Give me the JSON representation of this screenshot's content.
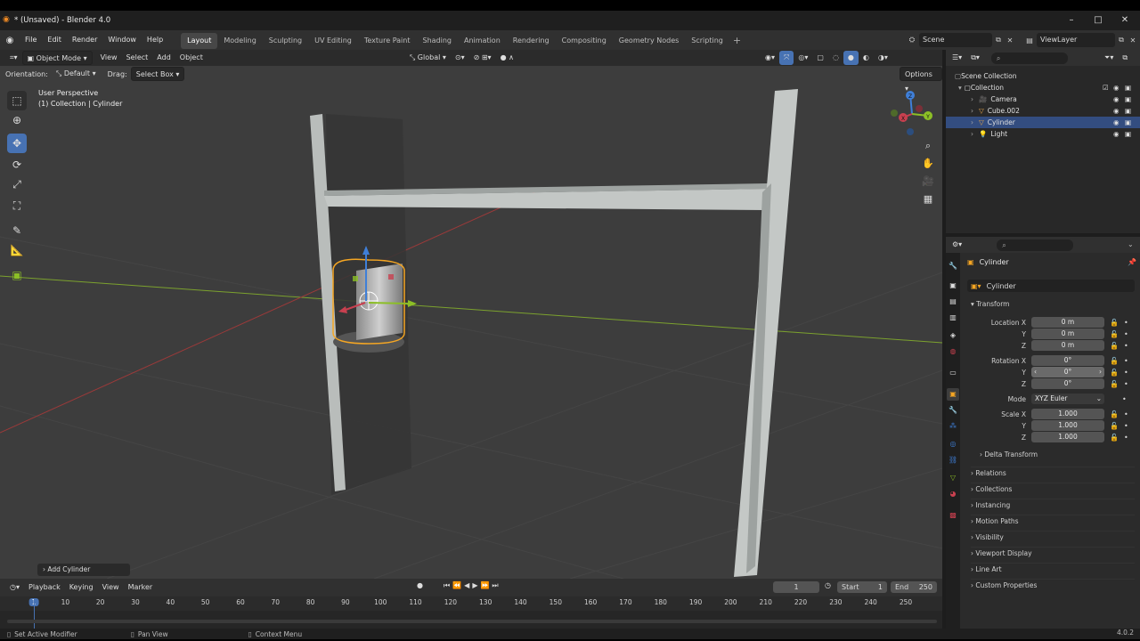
{
  "app": {
    "title": "* (Unsaved) - Blender 4.0",
    "version": "4.0.2"
  },
  "menus": [
    "File",
    "Edit",
    "Render",
    "Window",
    "Help"
  ],
  "workspaces": [
    "Layout",
    "Modeling",
    "Sculpting",
    "UV Editing",
    "Texture Paint",
    "Shading",
    "Animation",
    "Rendering",
    "Compositing",
    "Geometry Nodes",
    "Scripting"
  ],
  "active_workspace": "Layout",
  "scene": {
    "name": "Scene",
    "view_layer": "ViewLayer"
  },
  "viewport": {
    "mode": "Object Mode",
    "menus": [
      "View",
      "Select",
      "Add",
      "Object"
    ],
    "transform_space": "Global",
    "orientation_label": "Orientation:",
    "orientation_value": "Default",
    "drag_label": "Drag:",
    "drag_value": "Select Box",
    "options_label": "Options",
    "perspective": "User Perspective",
    "collection_info": "(1) Collection | Cylinder",
    "last_operator": "Add Cylinder",
    "gizmo_axes": [
      "X",
      "Y",
      "Z"
    ]
  },
  "outliner": {
    "root": "Scene Collection",
    "collection": "Collection",
    "items": [
      {
        "name": "Camera",
        "icon": "camera-icon",
        "selected": false
      },
      {
        "name": "Cube.002",
        "icon": "mesh-icon",
        "selected": false
      },
      {
        "name": "Cylinder",
        "icon": "mesh-icon",
        "selected": true
      },
      {
        "name": "Light",
        "icon": "light-icon",
        "selected": false
      }
    ]
  },
  "properties": {
    "object_name": "Cylinder",
    "object_field": "Cylinder",
    "transform_title": "Transform",
    "location": {
      "label": "Location X",
      "x": "0 m",
      "y": "0 m",
      "z": "0 m"
    },
    "rotation": {
      "label": "Rotation X",
      "x": "0°",
      "y": "0°",
      "z": "0°"
    },
    "mode_label": "Mode",
    "mode_value": "XYZ Euler",
    "scale": {
      "label": "Scale X",
      "x": "1.000",
      "y": "1.000",
      "z": "1.000"
    },
    "axis_y": "Y",
    "axis_z": "Z",
    "delta_transform": "Delta Transform",
    "panels": [
      "Relations",
      "Collections",
      "Instancing",
      "Motion Paths",
      "Visibility",
      "Viewport Display",
      "Line Art",
      "Custom Properties"
    ]
  },
  "timeline": {
    "menus": [
      "Playback",
      "Keying",
      "View",
      "Marker"
    ],
    "current_frame": "1",
    "start_label": "Start",
    "start": "1",
    "end_label": "End",
    "end": "250",
    "ticks": [
      "1",
      "10",
      "20",
      "30",
      "40",
      "50",
      "60",
      "70",
      "80",
      "90",
      "100",
      "110",
      "120",
      "130",
      "140",
      "150",
      "160",
      "170",
      "180",
      "190",
      "200",
      "210",
      "220",
      "230",
      "240",
      "250"
    ]
  },
  "statusbar": {
    "left": "Set Active Modifier",
    "middle": "Pan View",
    "right": "Context Menu"
  },
  "colors": {
    "accent": "#4772b3",
    "selection_orange": "#f5a623",
    "axis_x": "#c8404f",
    "axis_y": "#8cbf26",
    "axis_z": "#3f7fd8"
  }
}
